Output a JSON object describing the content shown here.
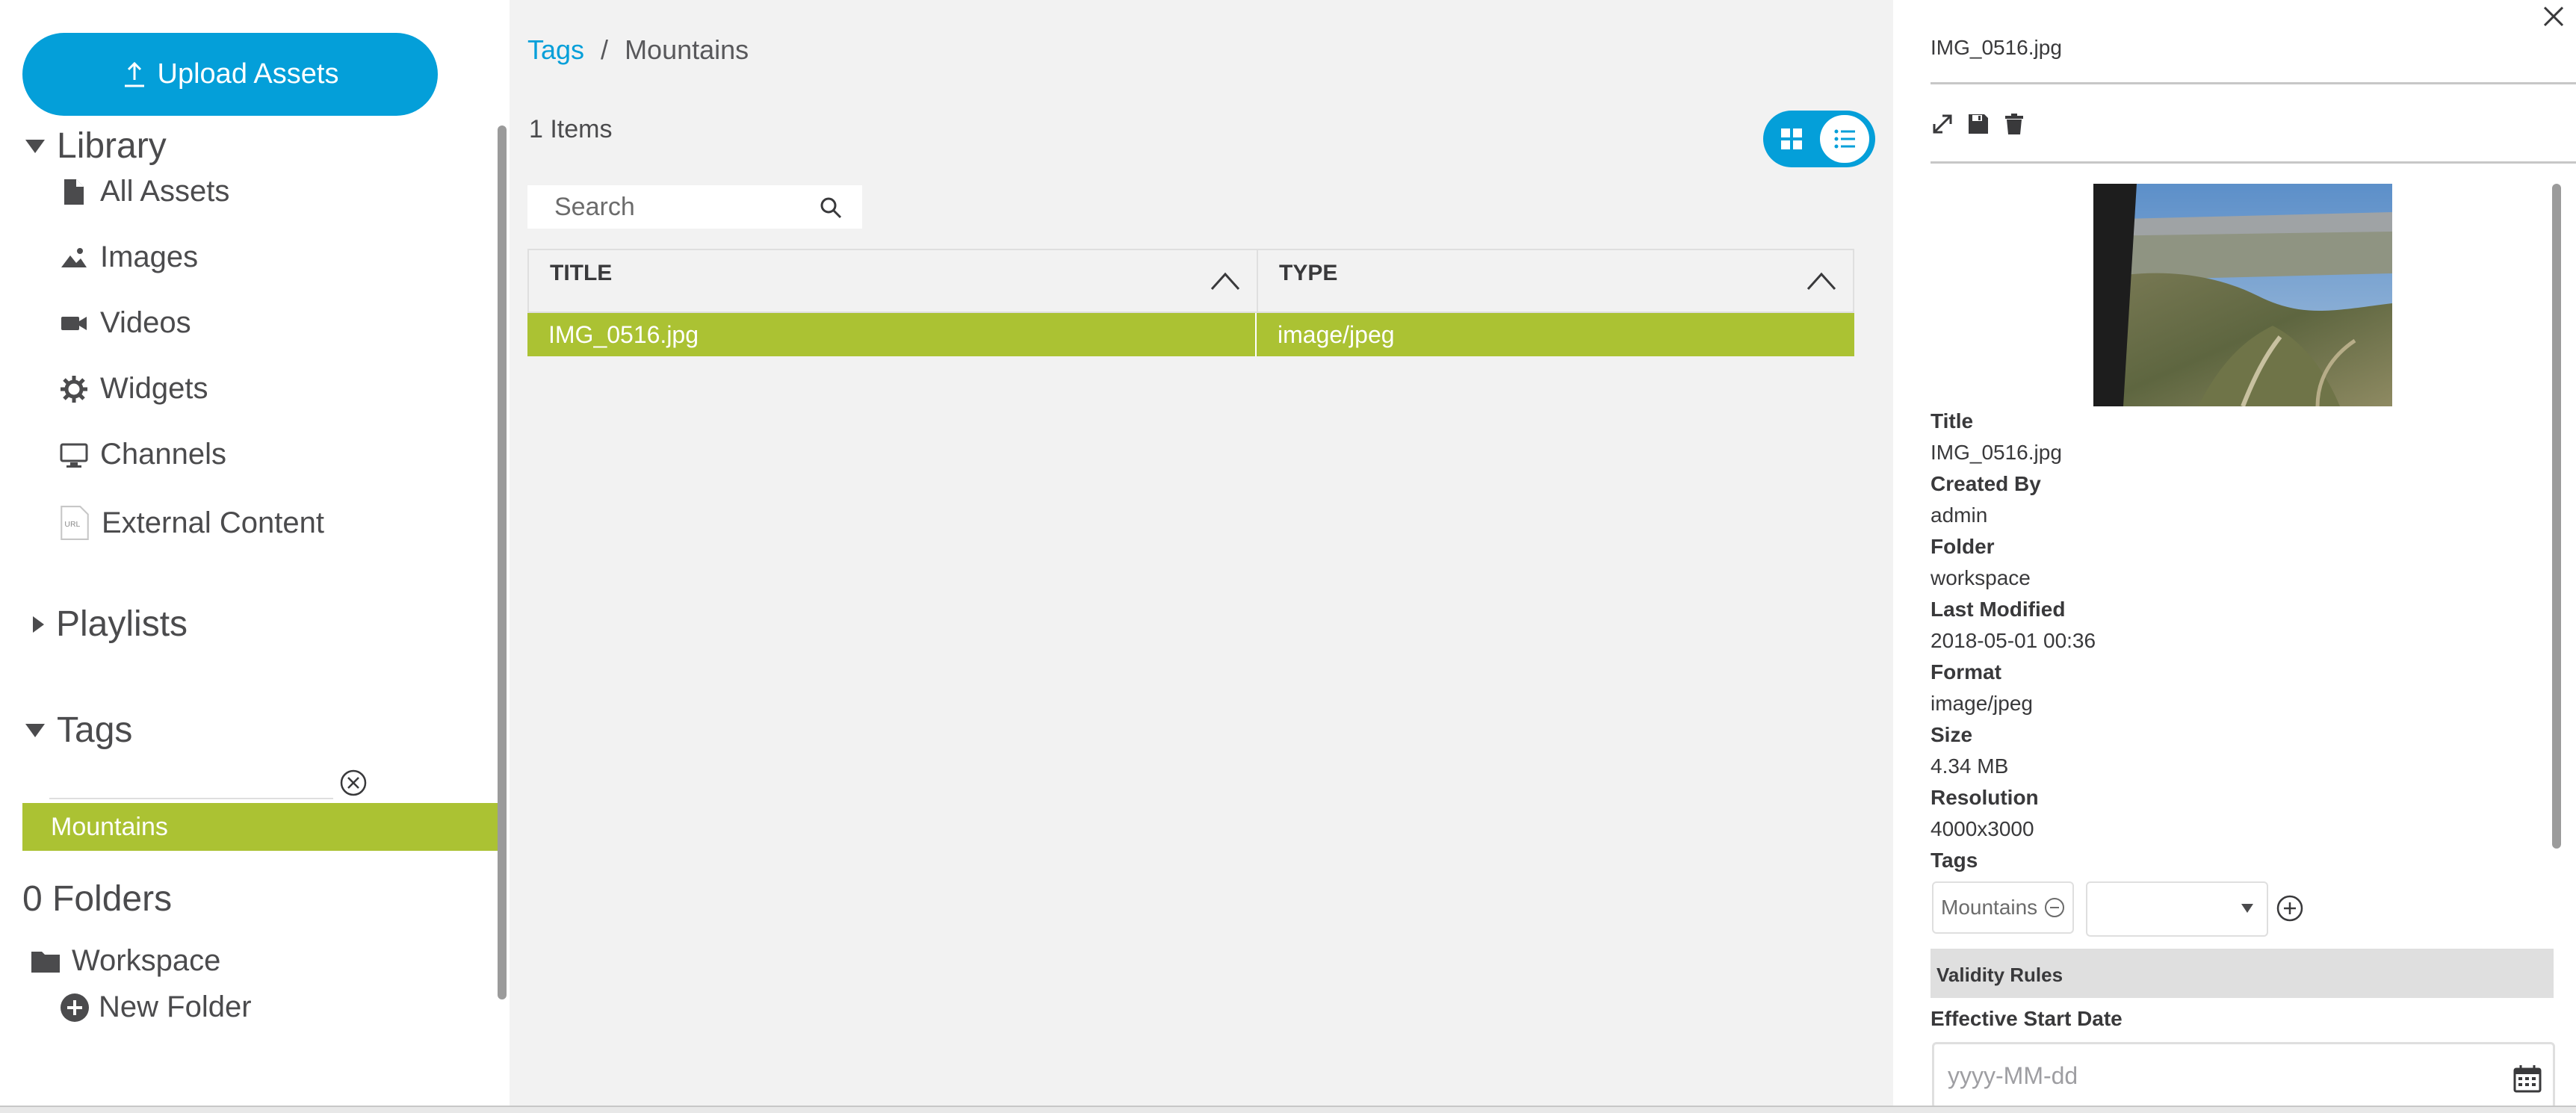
{
  "sidebar": {
    "upload_label": "Upload Assets",
    "library": {
      "label": "Library",
      "items": [
        {
          "label": "All Assets",
          "icon": "file-icon"
        },
        {
          "label": "Images",
          "icon": "image-icon"
        },
        {
          "label": "Videos",
          "icon": "video-icon"
        },
        {
          "label": "Widgets",
          "icon": "gear-icon"
        },
        {
          "label": "Channels",
          "icon": "monitor-icon"
        },
        {
          "label": "External Content",
          "icon": "url-icon"
        }
      ]
    },
    "playlists_label": "Playlists",
    "tags_label": "Tags",
    "tag_filter_value": "",
    "selected_tag": "Mountains",
    "folders_label": "0 Folders",
    "folder_name": "Workspace",
    "new_folder_label": "New Folder"
  },
  "main": {
    "breadcrumb": {
      "root": "Tags",
      "separator": "/",
      "current": "Mountains"
    },
    "item_count": "1 Items",
    "search_placeholder": "Search",
    "table": {
      "columns": [
        "TITLE",
        "TYPE"
      ],
      "rows": [
        {
          "title": "IMG_0516.jpg",
          "type": "image/jpeg"
        }
      ]
    }
  },
  "panel": {
    "file_name": "IMG_0516.jpg",
    "details": {
      "title_label": "Title",
      "title_value": "IMG_0516.jpg",
      "created_by_label": "Created By",
      "created_by_value": "admin",
      "folder_label": "Folder",
      "folder_value": "workspace",
      "modified_label": "Last Modified",
      "modified_value": "2018-05-01 00:36",
      "format_label": "Format",
      "format_value": "image/jpeg",
      "size_label": "Size",
      "size_value": "4.34 MB",
      "resolution_label": "Resolution",
      "resolution_value": "4000x3000",
      "tags_label": "Tags"
    },
    "tag_chip": "Mountains",
    "validity_label": "Validity Rules",
    "effective_start_label": "Effective Start Date",
    "date_placeholder": "yyyy-MM-dd"
  },
  "colors": {
    "accent": "#049fd9",
    "selected": "#abc233",
    "panel_bg": "#f2f2f2"
  }
}
